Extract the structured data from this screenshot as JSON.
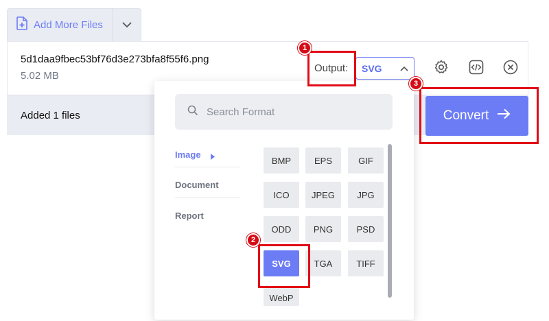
{
  "toolbar": {
    "add_files_label": "Add More Files"
  },
  "file": {
    "name": "5d1daa9fbec53bf76d3e273bfa8f55f6.png",
    "size": "5.02 MB",
    "added_text": "Added 1 files"
  },
  "output": {
    "label": "Output:",
    "selected": "SVG"
  },
  "convert_label": "Convert",
  "search": {
    "placeholder": "Search Format"
  },
  "categories": [
    {
      "label": "Image",
      "active": true
    },
    {
      "label": "Document",
      "active": false
    },
    {
      "label": "Report",
      "active": false
    }
  ],
  "formats": [
    "BMP",
    "EPS",
    "GIF",
    "ICO",
    "JPEG",
    "JPG",
    "ODD",
    "PNG",
    "PSD",
    "SVG",
    "TGA",
    "TIFF",
    "WebP"
  ],
  "selected_format": "SVG",
  "annotations": [
    "1",
    "2",
    "3"
  ],
  "colors": {
    "accent": "#6c7cf5",
    "annotation_red": "#e10b16"
  },
  "icons": [
    "file-plus-icon",
    "chevron-down-icon",
    "chevron-up-icon",
    "gear-icon",
    "code-icon",
    "close-circle-icon",
    "search-icon",
    "arrow-right-icon",
    "caret-right-icon"
  ]
}
